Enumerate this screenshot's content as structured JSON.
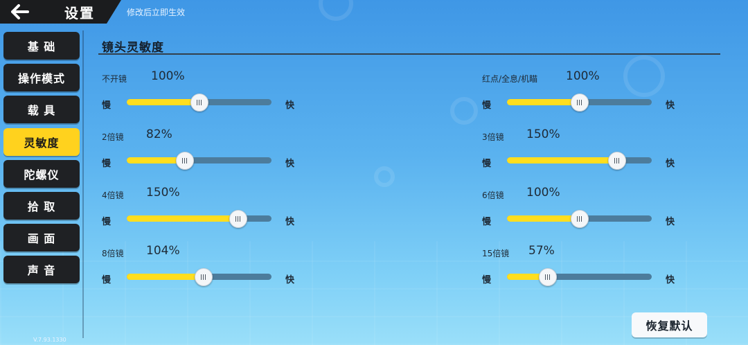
{
  "header": {
    "title": "设置",
    "hint": "修改后立即生效"
  },
  "sidebar": {
    "items": [
      {
        "label": "基 础",
        "active": false
      },
      {
        "label": "操作模式",
        "active": false
      },
      {
        "label": "载 具",
        "active": false
      },
      {
        "label": "灵敏度",
        "active": true
      },
      {
        "label": "陀螺仪",
        "active": false
      },
      {
        "label": "拾 取",
        "active": false
      },
      {
        "label": "画 面",
        "active": false
      },
      {
        "label": "声 音",
        "active": false
      }
    ]
  },
  "version": "V.7.93.1330",
  "section": {
    "title": "镜头灵敏度"
  },
  "slider_common": {
    "slow": "慢",
    "fast": "快"
  },
  "sliders": [
    {
      "label": "不开镜",
      "value": "100%",
      "position": 0.5
    },
    {
      "label": "红点/全息/机瞄",
      "value": "100%",
      "position": 0.5
    },
    {
      "label": "2倍镜",
      "value": "82%",
      "position": 0.4
    },
    {
      "label": "3倍镜",
      "value": "150%",
      "position": 0.76
    },
    {
      "label": "4倍镜",
      "value": "150%",
      "position": 0.77
    },
    {
      "label": "6倍镜",
      "value": "100%",
      "position": 0.5
    },
    {
      "label": "8倍镜",
      "value": "104%",
      "position": 0.53
    },
    {
      "label": "15倍镜",
      "value": "57%",
      "position": 0.28
    }
  ],
  "reset_button": {
    "label": "恢复默认"
  },
  "colors": {
    "accent": "#ffd21e",
    "sidebar_bg": "#1f2124",
    "track": "#4c7c9c",
    "fill": "#ffde1f"
  }
}
